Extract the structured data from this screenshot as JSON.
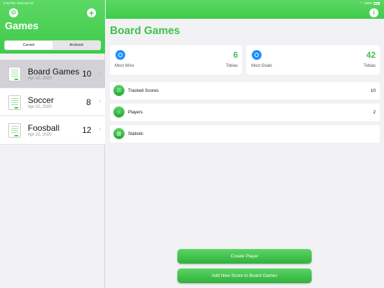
{
  "status": {
    "time": "9:49 PM",
    "date": "Wed Apr 22",
    "battery": "100%"
  },
  "sidebar": {
    "title": "Games",
    "segments": [
      "Current",
      "Archived"
    ],
    "games": [
      {
        "name": "Board Games",
        "date": "Apr 22, 2020",
        "score": "10"
      },
      {
        "name": "Soccer",
        "date": "Apr 22, 2020",
        "score": "8"
      },
      {
        "name": "Foosball",
        "date": "Apr 22, 2020",
        "score": "12"
      }
    ]
  },
  "main": {
    "title": "Board Games",
    "stats": [
      {
        "label": "Most Wins",
        "value": "6",
        "player": "Tobias"
      },
      {
        "label": "Most Goals",
        "value": "42",
        "player": "Tobias"
      }
    ],
    "rows": [
      {
        "label": "Tracked Scores",
        "count": "10"
      },
      {
        "label": "Players",
        "count": "2"
      },
      {
        "label": "Statistic",
        "count": ""
      }
    ],
    "buttons": {
      "create_player": "Create Player",
      "add_score": "Add New Score to Board Games"
    }
  },
  "colors": {
    "accent": "#3ecb4a",
    "stat_icon": "#1e8fff"
  }
}
